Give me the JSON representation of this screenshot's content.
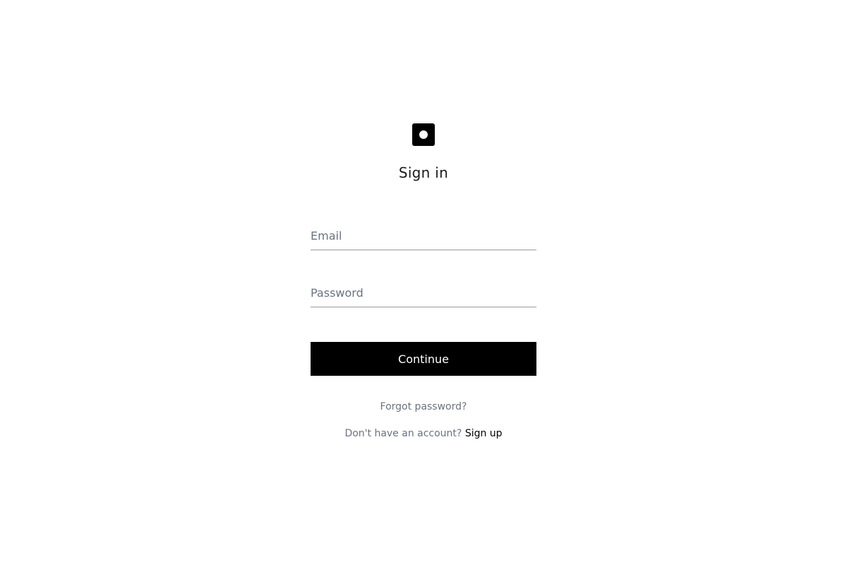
{
  "logo": {
    "icon": "square-dot-logo-icon",
    "color": "#000000"
  },
  "title": "Sign in",
  "form": {
    "email": {
      "value": "",
      "placeholder": "Email"
    },
    "password": {
      "value": "",
      "placeholder": "Password"
    },
    "continue_label": "Continue"
  },
  "links": {
    "forgot_password": "Forgot password?",
    "no_account_text": "Don't have an account?",
    "sign_up": "Sign up"
  },
  "colors": {
    "accent": "#000000",
    "muted_text": "#6b7280",
    "background": "#ffffff"
  }
}
